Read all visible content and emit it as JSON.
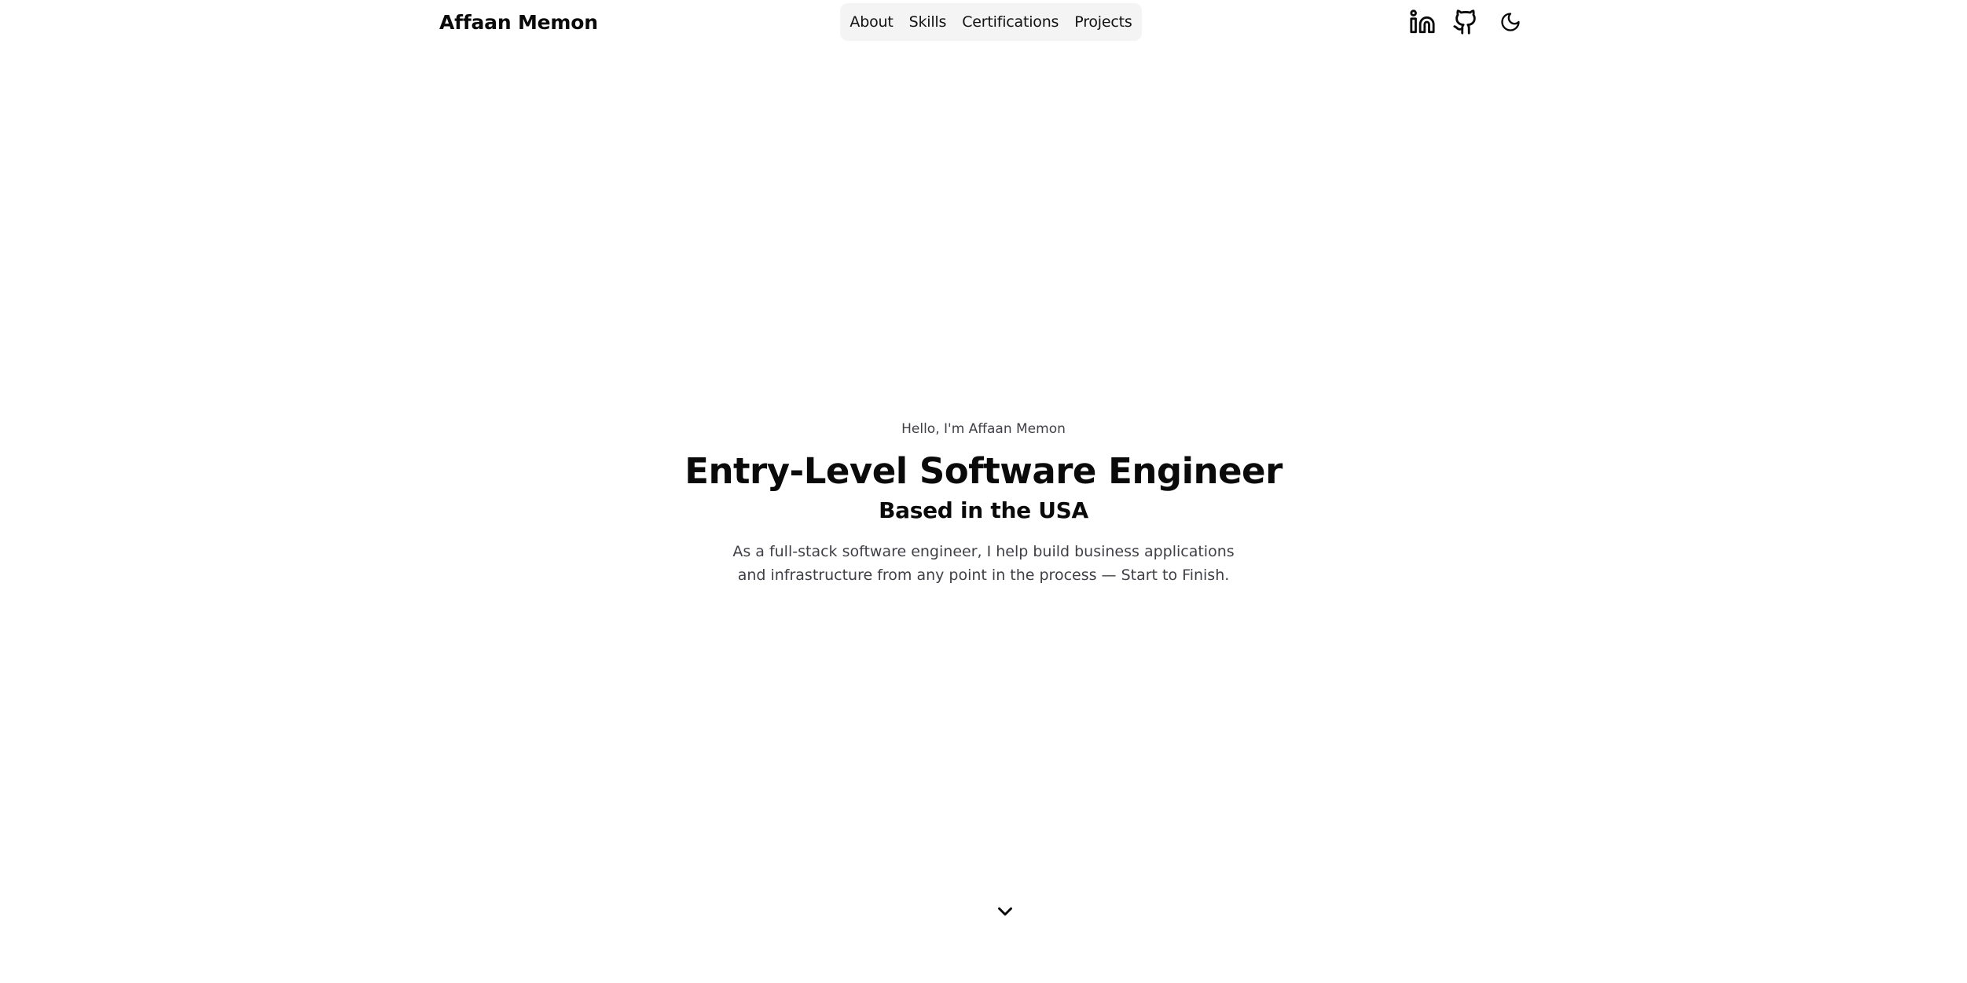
{
  "header": {
    "site_title": "Affaan Memon",
    "nav": [
      {
        "label": "About"
      },
      {
        "label": "Skills"
      },
      {
        "label": "Certifications"
      },
      {
        "label": "Projects"
      }
    ],
    "icons": {
      "linkedin": "linkedin-icon",
      "github": "github-icon",
      "theme_toggle": "moon-icon"
    }
  },
  "hero": {
    "greeting": "Hello, I'm Affaan Memon",
    "title": "Entry-Level Software Engineer",
    "subtitle": "Based in the USA",
    "description": "As a full-stack software engineer, I help build business applications and infrastructure from any point in the process — Start to Finish."
  },
  "scroll_indicator": {
    "icon": "chevron-down-icon"
  },
  "colors": {
    "background": "#ffffff",
    "text": "#0a0a0a",
    "muted_text": "#3f3f46",
    "nav_background": "#f4f4f5"
  }
}
